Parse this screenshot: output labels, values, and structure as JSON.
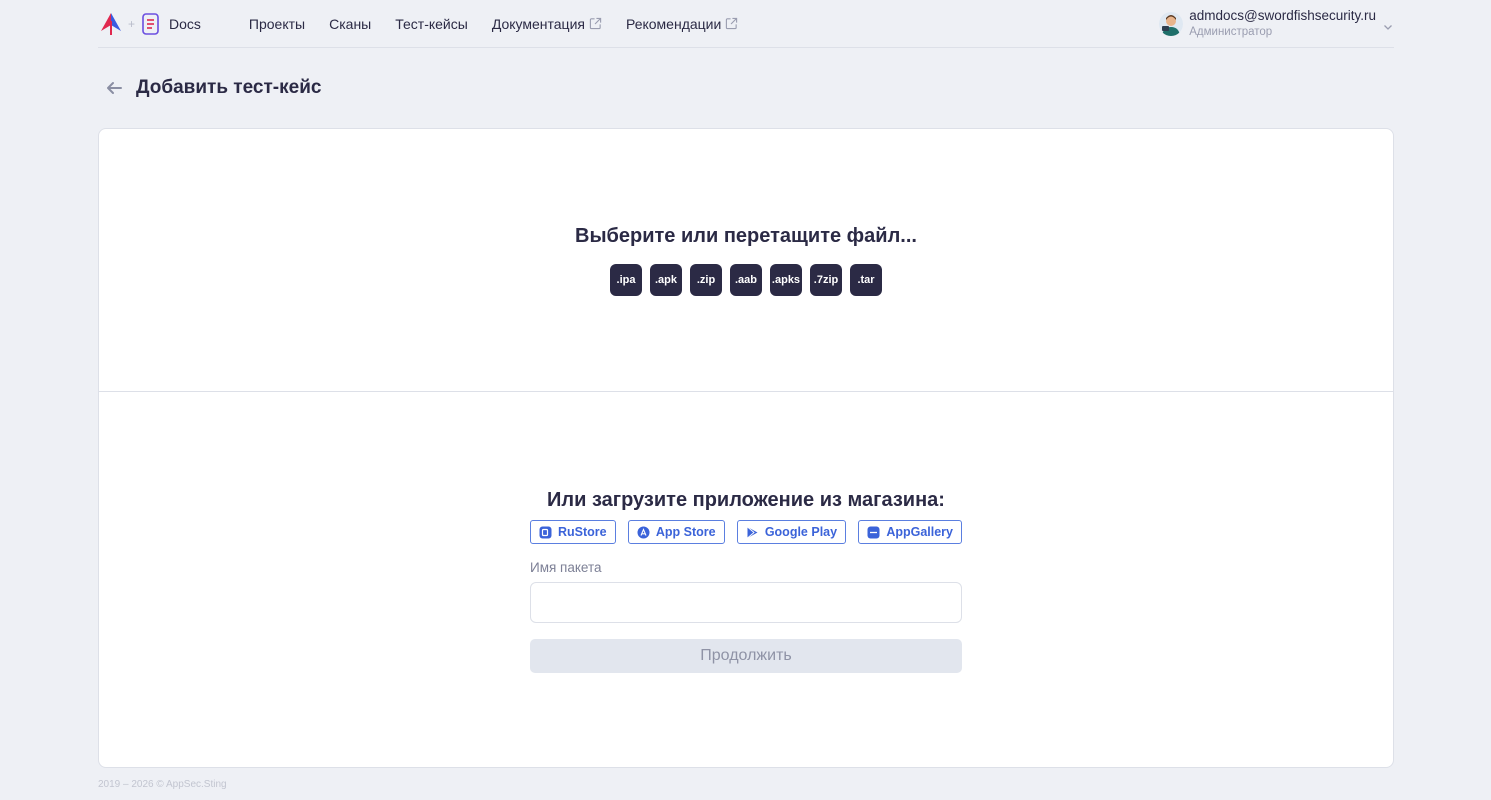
{
  "header": {
    "docs_label": "Docs",
    "plus": "+",
    "nav": [
      {
        "label": "Проекты",
        "external": false
      },
      {
        "label": "Сканы",
        "external": false
      },
      {
        "label": "Тест-кейсы",
        "external": false
      },
      {
        "label": "Документация",
        "external": true
      },
      {
        "label": "Рекомендации",
        "external": true
      }
    ],
    "user": {
      "email": "admdocs@swordfishsecurity.ru",
      "role": "Администратор"
    }
  },
  "page": {
    "title": "Добавить тест-кейс"
  },
  "dropzone": {
    "title": "Выберите или перетащите файл...",
    "extensions": [
      ".ipa",
      ".apk",
      ".zip",
      ".aab",
      ".apks",
      ".7zip",
      ".tar"
    ]
  },
  "store": {
    "title": "Или загрузите приложение из магазина:",
    "buttons": [
      {
        "label": "RuStore",
        "icon": "rustore-icon"
      },
      {
        "label": "App Store",
        "icon": "appstore-icon"
      },
      {
        "label": "Google Play",
        "icon": "googleplay-icon"
      },
      {
        "label": "AppGallery",
        "icon": "appgallery-icon"
      }
    ],
    "package_label": "Имя пакета",
    "package_value": "",
    "package_placeholder": "",
    "continue_label": "Продолжить"
  },
  "footer": {
    "text": "2019 – 2026 © AppSec.Sting"
  },
  "colors": {
    "background": "#eef0f5",
    "text": "#2b2a45",
    "accent": "#3b63d9",
    "badge": "#2b2a45",
    "disabled_button": "#e2e6ee"
  }
}
